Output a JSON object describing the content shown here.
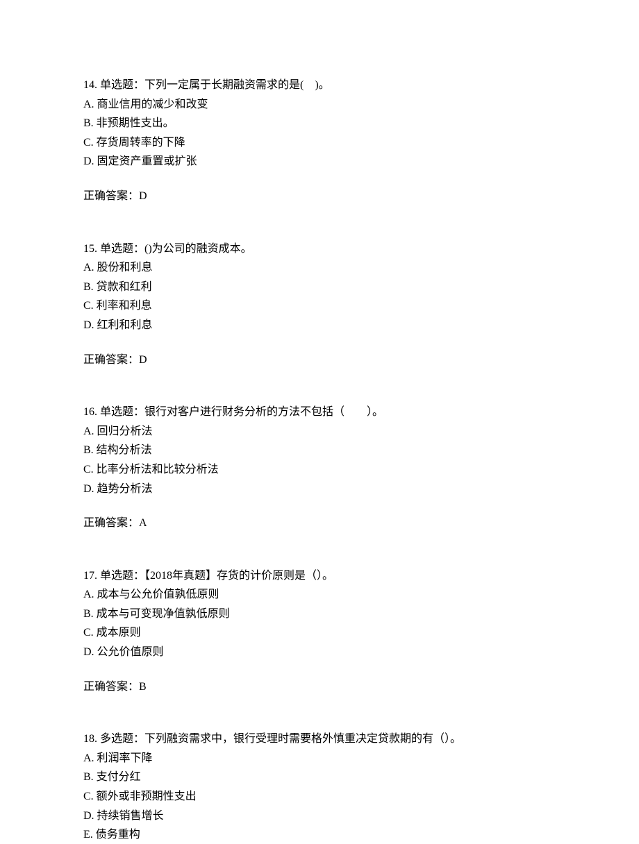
{
  "questions": [
    {
      "number": "14.",
      "type": "单选题：",
      "stem": "下列一定属于长期融资需求的是(　)。",
      "options": [
        "A. 商业信用的减少和改变",
        "B. 非预期性支出。",
        "C. 存货周转率的下降",
        "D. 固定资产重置或扩张"
      ],
      "answer_label": "正确答案：",
      "answer": "D"
    },
    {
      "number": "15.",
      "type": "单选题：",
      "stem": "()为公司的融资成本。",
      "options": [
        "A. 股份和利息",
        "B. 贷款和红利",
        "C. 利率和利息",
        "D. 红利和利息"
      ],
      "answer_label": "正确答案：",
      "answer": "D"
    },
    {
      "number": "16.",
      "type": "单选题：",
      "stem": "银行对客户进行财务分析的方法不包括（　　）。",
      "options": [
        "A. 回归分析法",
        "B. 结构分析法",
        "C. 比率分析法和比较分析法",
        "D. 趋势分析法"
      ],
      "answer_label": "正确答案：",
      "answer": "A"
    },
    {
      "number": "17.",
      "type": "单选题：",
      "stem": "【2018年真题】存货的计价原则是（）。",
      "options": [
        "A. 成本与公允价值孰低原则",
        "B. 成本与可变现净值孰低原则",
        "C. 成本原则",
        "D. 公允价值原则"
      ],
      "answer_label": "正确答案：",
      "answer": "B"
    },
    {
      "number": "18.",
      "type": "多选题：",
      "stem": "下列融资需求中，银行受理时需要格外慎重决定贷款期的有（）。",
      "options": [
        "A. 利润率下降",
        "B. 支付分红",
        "C. 额外或非预期性支出",
        "D. 持续销售增长",
        "E. 债务重构"
      ],
      "answer_label": "",
      "answer": ""
    }
  ]
}
